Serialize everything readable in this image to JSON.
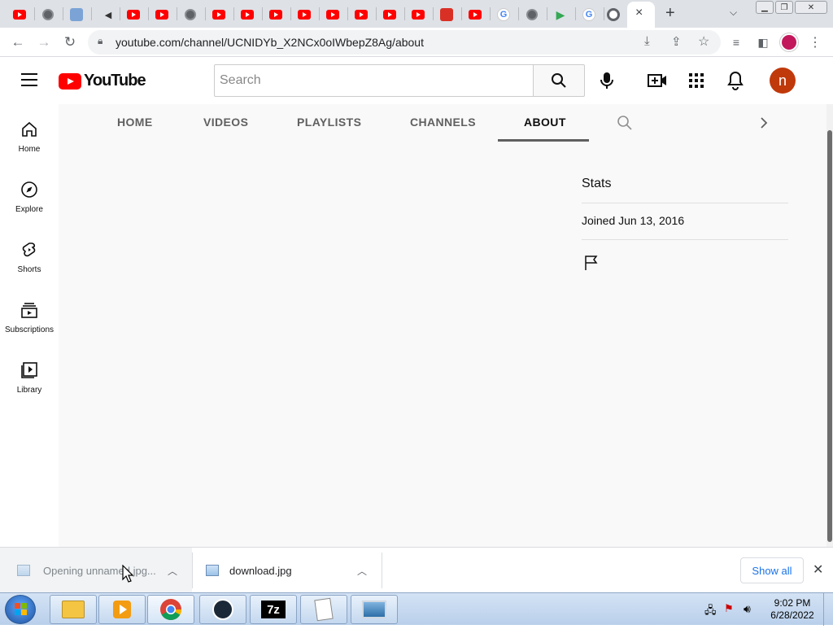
{
  "browser": {
    "url": "youtube.com/channel/UCNIDYb_X2NCx0oIWbepZ8Ag/about",
    "new_tab_symbol": "+",
    "close_tab_symbol": "×"
  },
  "youtube": {
    "logo_text": "YouTube",
    "search_placeholder": "Search",
    "avatar_letter": "n",
    "avatar_color": "#c0390b",
    "brand_red": "#ff0000"
  },
  "sidebar": {
    "items": [
      {
        "label": "Home",
        "icon": "home-icon"
      },
      {
        "label": "Explore",
        "icon": "compass-icon"
      },
      {
        "label": "Shorts",
        "icon": "shorts-icon"
      },
      {
        "label": "Subscriptions",
        "icon": "subscriptions-icon"
      },
      {
        "label": "Library",
        "icon": "library-icon"
      }
    ]
  },
  "channel_tabs": {
    "items": [
      {
        "label": "HOME"
      },
      {
        "label": "VIDEOS"
      },
      {
        "label": "PLAYLISTS"
      },
      {
        "label": "CHANNELS"
      },
      {
        "label": "ABOUT"
      }
    ],
    "selected": "ABOUT"
  },
  "about": {
    "stats_title": "Stats",
    "joined": "Joined Jun 13, 2016"
  },
  "downloads": {
    "items": [
      {
        "name": "Opening unnamed.jpg..."
      },
      {
        "name": "download.jpg"
      }
    ],
    "show_all_label": "Show all"
  },
  "taskbar": {
    "time": "9:02 PM",
    "date": "6/28/2022"
  }
}
